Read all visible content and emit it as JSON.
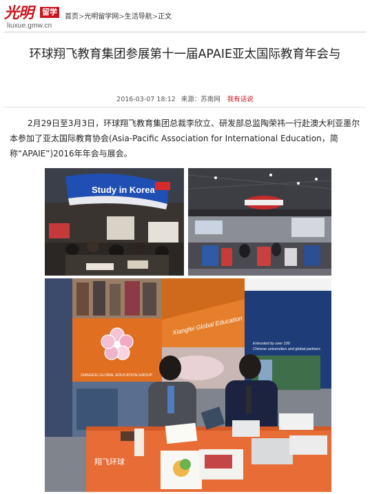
{
  "header": {
    "logo_text": "光明",
    "logo_badge": "留学",
    "logo_url": "liuxue.gmw.cn",
    "breadcrumb": [
      "首页",
      "光明留学网",
      "生活导航",
      "正文"
    ],
    "separator": ">"
  },
  "article": {
    "title": "环球翔飞教育集团参展第十一届APAIE亚太国际教育年会与",
    "date": "2016-03-07 18:12",
    "source": "来源：苏南网",
    "report_link": "我有话说",
    "body": "2月29日至3月3日，环球翔飞教育集团总裁李欣立、研发部总监陶荣祎一行赴澳大利亚墨尔本参加了亚太国际教育协会(Asia-Pacific Association for International Education，简称“APAIE”)2016年年会与展会。"
  },
  "photos": {
    "photo1_sign": "Study in Korea",
    "photo3_banner_left": "XIANGFEI GLOBAL EDUCATION GROUP",
    "photo3_banner_middle": "Xiangfei Global Education",
    "photo3_banner_right_line1": "Entrusted by over 100",
    "photo3_banner_right_line2": "Chinese universities and global partners",
    "photo3_brochure": "翔飞环球"
  }
}
